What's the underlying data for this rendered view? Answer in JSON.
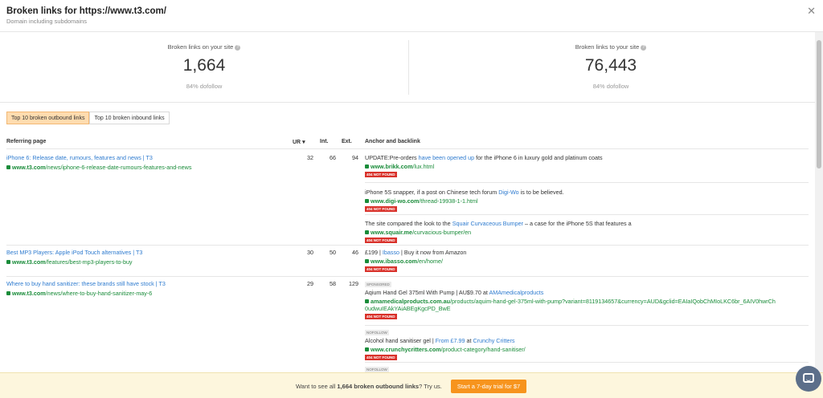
{
  "header": {
    "title": "Broken links for https://www.t3.com/",
    "subtitle": "Domain including subdomains",
    "close_icon": "close-icon"
  },
  "stats": {
    "left": {
      "label": "Broken links on your site",
      "value": "1,664",
      "sub": "84% dofollow"
    },
    "right": {
      "label": "Broken links to your site",
      "value": "76,443",
      "sub": "84% dofollow"
    }
  },
  "tabs": [
    {
      "label": "Top 10 broken outbound links",
      "active": true
    },
    {
      "label": "Top 10 broken inbound links",
      "active": false
    }
  ],
  "table": {
    "columns": {
      "referring_page": "Referring page",
      "ur": "UR",
      "int": "Int.",
      "ext": "Ext.",
      "anchor": "Anchor and backlink"
    },
    "rows": [
      {
        "title": "iPhone 6: Release date, rumours, features and news | T3",
        "url_domain": "www.t3.com",
        "url_path": "/news/iphone-6-release-date-rumours-features-and-news",
        "ur": "32",
        "int": "66",
        "ext": "94",
        "anchors": [
          {
            "pre": "UPDATE:Pre-orders ",
            "link": "have been opened up",
            "post": " for the iPhone 6 in luxury gold and platinum coats",
            "domain": "www.brikk.com",
            "path": "/lux.html",
            "status": "404 NOT FOUND"
          },
          {
            "pre": "iPhone 5S snapper, if a post on Chinese tech forum ",
            "link": "Digi-Wo",
            "post": " is to be believed.",
            "domain": "www.digi-wo.com",
            "path": "/thread-19938-1-1.html",
            "status": "404 NOT FOUND"
          },
          {
            "pre": "The site compared the look to the ",
            "link": "Squair Curvaceous Bumper",
            "post": " – a case for the iPhone 5S that features a",
            "domain": "www.squair.me",
            "path": "/curvacious-bumper/en",
            "status": "404 NOT FOUND"
          }
        ]
      },
      {
        "title": "Best MP3 Players: Apple iPod Touch alternatives | T3",
        "url_domain": "www.t3.com",
        "url_path": "/features/best-mp3-players-to-buy",
        "ur": "30",
        "int": "50",
        "ext": "46",
        "anchors": [
          {
            "pre": "£199 | ",
            "link": "Ibasso",
            "post": " | Buy it now from Amazon",
            "domain": "www.ibasso.com",
            "path": "/en/home/",
            "status": "404 NOT FOUND"
          }
        ]
      },
      {
        "title": "Where to buy hand sanitizer: these brands still have stock | T3",
        "url_domain": "www.t3.com",
        "url_path": "/news/where-to-buy-hand-sanitizer-may-6",
        "ur": "29",
        "int": "58",
        "ext": "129",
        "anchors": [
          {
            "tag": "SPONSORED",
            "pre": "Aqium Hand Gel 375ml With Pump | AU$9.70 at ",
            "link": "AMAmedicalproducts",
            "post": "",
            "domain": "amamedicalproducts.com.au",
            "path": "/products/aquim-hand-gel-375ml-with-pump?variant=8119134657&currency=AUD&gclid=EAIaIQobChMIoLKC6br_6AIV0hwrCh",
            "path2": "0udwuIEAkYAiABEgKgcPD_BwE",
            "status": "404 NOT FOUND"
          },
          {
            "tag": "NOFOLLOW",
            "pre": "Alcohol hand sanitiser gel | ",
            "link": "From £7.99",
            "post": " at ",
            "link2": "Crunchy Critters",
            "domain": "www.crunchycritters.com",
            "path": "/product-category/hand-sanitiser/",
            "status": "404 NOT FOUND"
          },
          {
            "tag": "NOFOLLOW"
          }
        ]
      }
    ]
  },
  "footer": {
    "text_pre": "Want to see all ",
    "text_bold": "1,664 broken outbound links",
    "text_post": "? Try us.",
    "cta": "Start a 7-day trial for $7"
  },
  "icons": {
    "help": "question-icon",
    "chat": "chat-icon",
    "lock": "lock-icon",
    "sort": "sort-down-icon"
  },
  "colors": {
    "link": "#2e7bcf",
    "url": "#1a8c3a",
    "badge": "#d9322b",
    "cta": "#f7941d",
    "active_tab": "#ffdcaf"
  }
}
